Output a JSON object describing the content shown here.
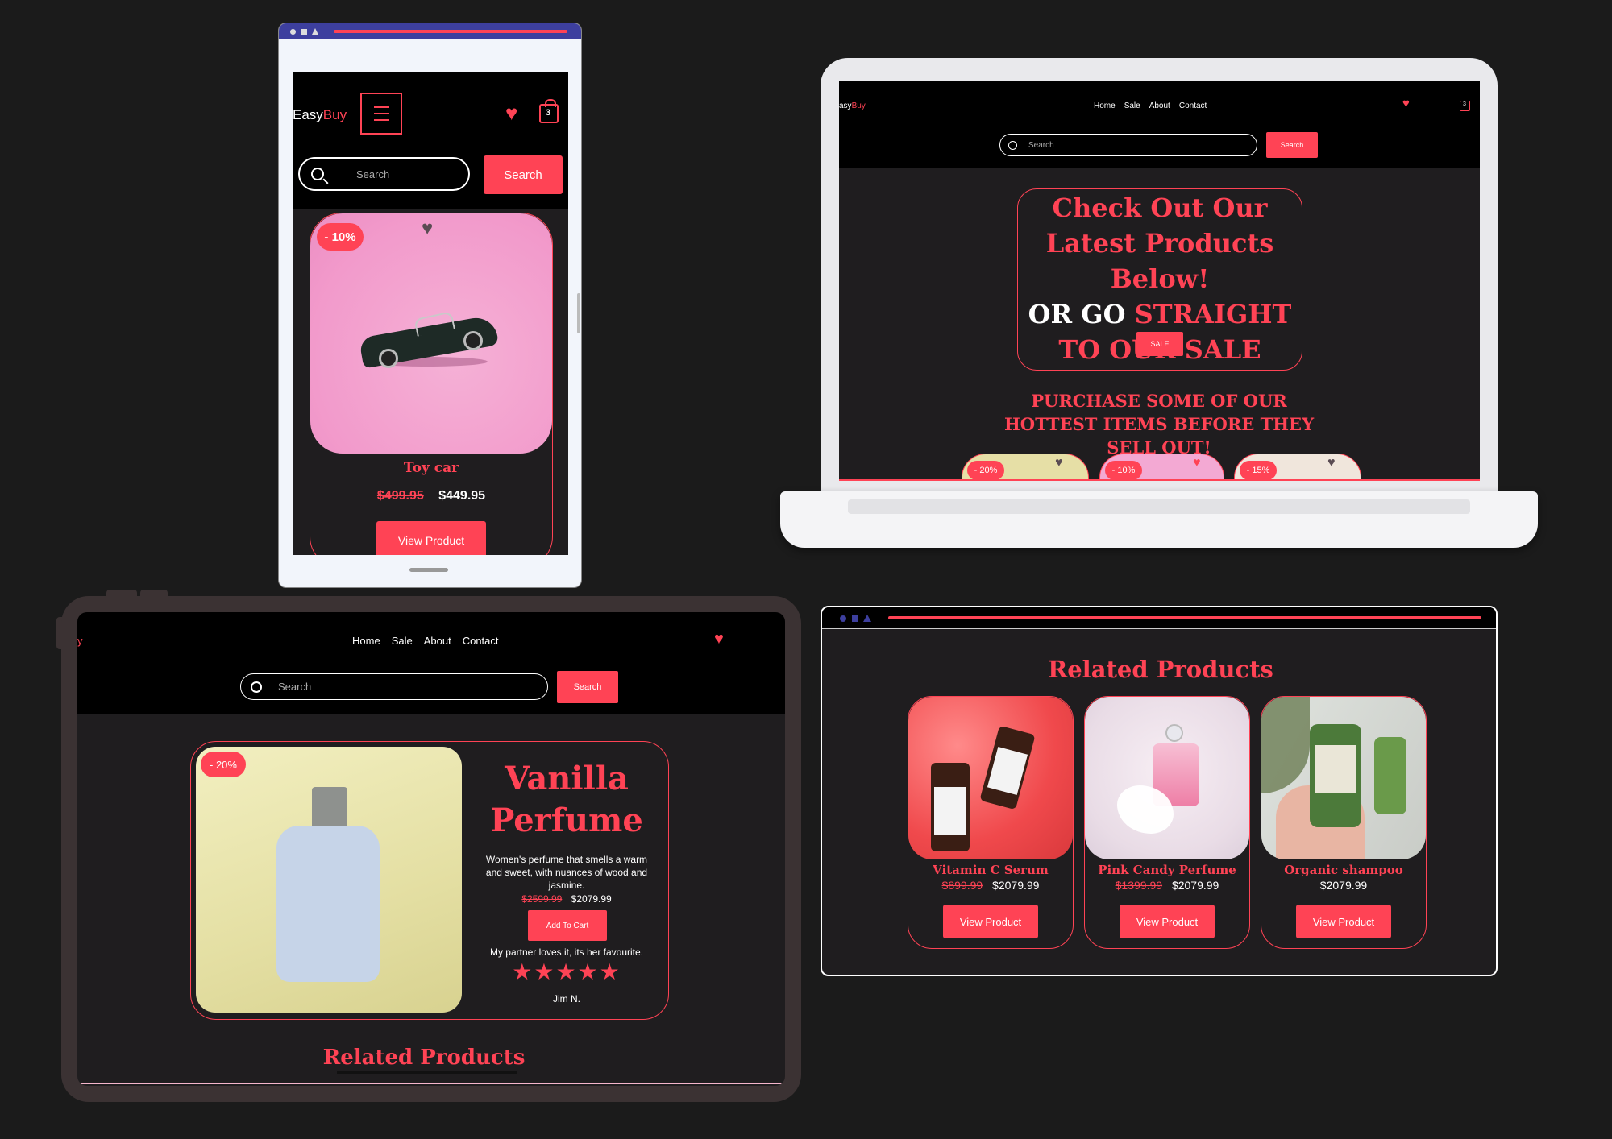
{
  "brand": {
    "easy": "Easy",
    "buy": "Buy",
    "laptop_truncated": "asyBuy",
    "tablet_truncated": "y"
  },
  "colors": {
    "accent": "#ff4355",
    "background": "#1b1b1b",
    "header": "#000000",
    "page": "#1f1d1f"
  },
  "nav": {
    "home": "Home",
    "sale": "Sale",
    "about": "About",
    "contact": "Contact"
  },
  "search": {
    "placeholder": "Search",
    "button": "Search"
  },
  "cart": {
    "count": "3"
  },
  "phone": {
    "discount": "- 10%",
    "product_name": "Toy car",
    "old_price": "$499.95",
    "new_price": "$449.95",
    "view_button": "View Product"
  },
  "laptop": {
    "hero_line1": "Check Out Our Latest Products Below!",
    "hero_or_go": "OR GO",
    "hero_straight": "STRAIGHT TO OUR SALE",
    "sale_button": "SALE",
    "hot_items": "PURCHASE SOME OF OUR HOTTEST ITEMS BEFORE THEY SELL OUT!",
    "badges": [
      "- 20%",
      "- 10%",
      "- 15%"
    ]
  },
  "tablet": {
    "discount": "- 20%",
    "product_title": "Vanilla Perfume",
    "description": "Women's perfume that smells a warm and sweet, with nuances of wood and jasmine.",
    "old_price": "$2599.99",
    "new_price": "$2079.99",
    "add_to_cart": "Add To Cart",
    "review_text": "My partner loves it, its her favourite.",
    "rating": 5,
    "stars": "★★★★★",
    "reviewer": "Jim N.",
    "related_title": "Related Products"
  },
  "related": {
    "title": "Related Products",
    "items": [
      {
        "name": "Vitamin C Serum",
        "old_price": "$899.99",
        "new_price": "$2079.99",
        "button": "View Product"
      },
      {
        "name": "Pink Candy Perfume",
        "old_price": "$1399.99",
        "new_price": "$2079.99",
        "button": "View Product"
      },
      {
        "name": "Organic shampoo",
        "old_price": "",
        "new_price": "$2079.99",
        "button": "View Product"
      }
    ]
  }
}
